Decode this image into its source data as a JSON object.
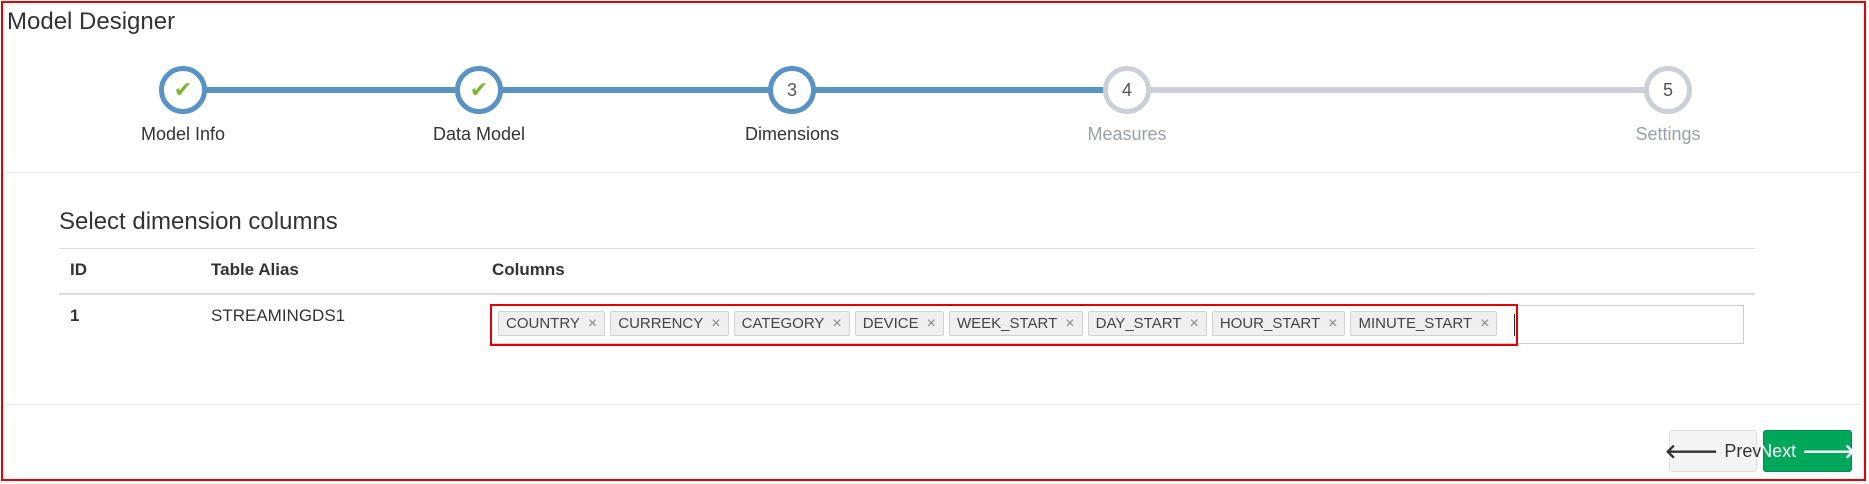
{
  "page": {
    "title": "Model Designer"
  },
  "wizard": {
    "progress_completed_fraction": 0.62,
    "steps": [
      {
        "number": "1",
        "label": "Model Info",
        "state": "done",
        "icon": "check-icon"
      },
      {
        "number": "2",
        "label": "Data Model",
        "state": "done",
        "icon": "check-icon"
      },
      {
        "number": "3",
        "label": "Dimensions",
        "state": "active"
      },
      {
        "number": "4",
        "label": "Measures",
        "state": "todo"
      },
      {
        "number": "5",
        "label": "Settings",
        "state": "todo"
      }
    ]
  },
  "section": {
    "title": "Select dimension columns",
    "headers": {
      "id": "ID",
      "alias": "Table Alias",
      "columns": "Columns"
    },
    "rows": [
      {
        "id": "1",
        "alias": "STREAMINGDS1",
        "tags": [
          "COUNTRY",
          "CURRENCY",
          "CATEGORY",
          "DEVICE",
          "WEEK_START",
          "DAY_START",
          "HOUR_START",
          "MINUTE_START"
        ]
      }
    ]
  },
  "actions": {
    "prev_label": "Prev",
    "next_label": "Next",
    "prev_icon": "arrow-left-icon",
    "next_icon": "arrow-right-icon"
  },
  "colors": {
    "accent": "#5893c4",
    "check": "#7ab730",
    "next_button": "#00a65a",
    "highlight": "#e60000"
  }
}
